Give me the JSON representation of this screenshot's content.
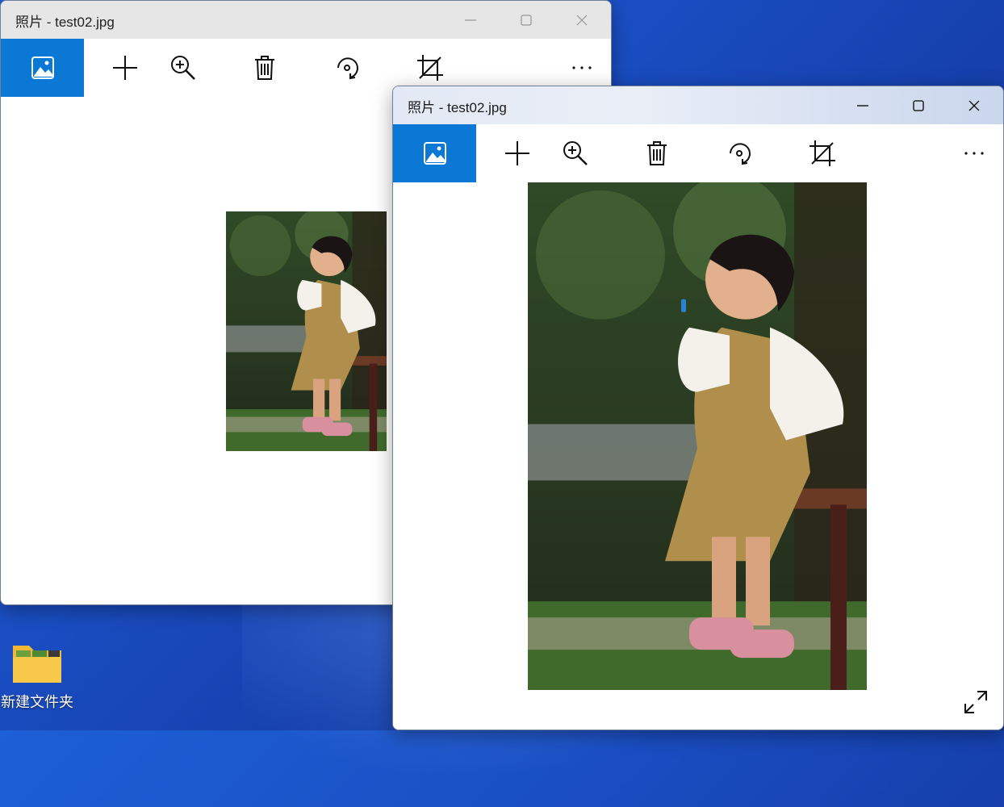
{
  "windows": [
    {
      "title": "照片 - test02.jpg",
      "state": "inactive"
    },
    {
      "title": "照片 - test02.jpg",
      "state": "active"
    }
  ],
  "toolbar_icons": [
    "image-icon",
    "add-icon",
    "zoom-in-icon",
    "delete-icon",
    "rotate-icon",
    "crop-icon",
    "more-icon"
  ],
  "window_controls": [
    "minimize-icon",
    "maximize-icon",
    "close-icon"
  ],
  "desktop": {
    "items": [
      {
        "label": "新建文件夹",
        "icon": "folder-icon"
      }
    ]
  },
  "colors": {
    "accent": "#0a78d4",
    "desktop": "#1a4fc4"
  }
}
